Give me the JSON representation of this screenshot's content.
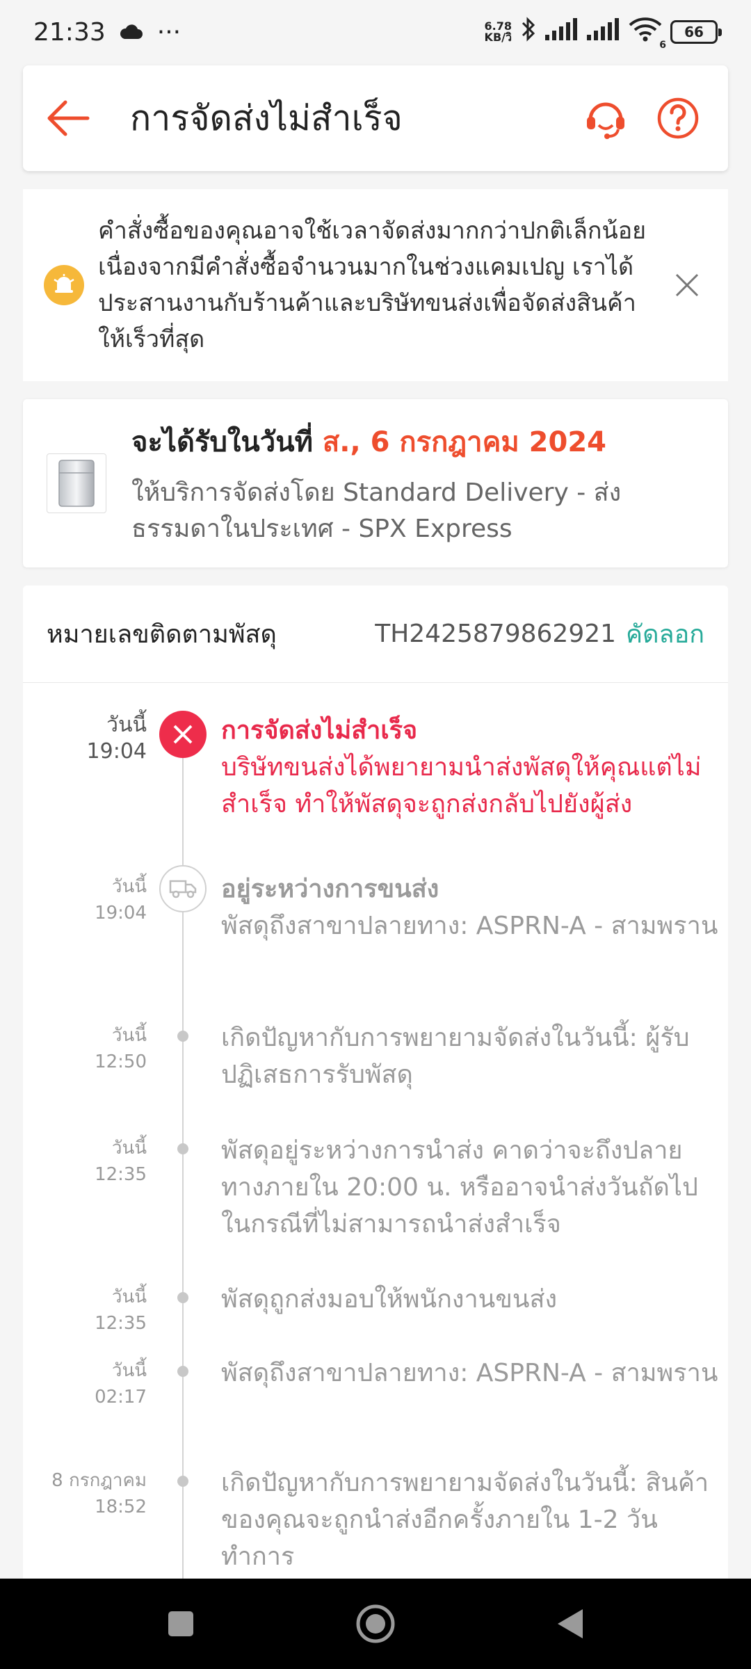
{
  "status_bar": {
    "time": "21:33",
    "dots": "···",
    "net_speed_value": "6.78",
    "net_speed_unit": "KB/วิ",
    "battery": "66",
    "wifi_sub": "6"
  },
  "header": {
    "title": "การจัดส่งไม่สำเร็จ",
    "accent_color": "#ee4d2d"
  },
  "notice": {
    "text": "คำสั่งซื้อของคุณอาจใช้เวลาจัดส่งมากกว่าปกติเล็กน้อย เนื่องจากมีคำสั่งซื้อจำนวนมากในช่วงแคมเปญ เราได้ประสานงานกับร้านค้าและบริษัทขนส่งเพื่อจัดส่งสินค้าให้เร็วที่สุด"
  },
  "delivery": {
    "label": "จะได้รับในวันที่ ",
    "date": "ส., 6 กรกฎาคม 2024",
    "service": "ให้บริการจัดส่งโดย Standard Delivery - ส่งธรรมดาในประเทศ - SPX Express"
  },
  "tracking": {
    "label": "หมายเลขติดตามพัสดุ",
    "number": "TH2425879862921",
    "copy_label": "คัดลอก",
    "events": [
      {
        "day": "วันนี้",
        "time": "19:04",
        "title": "การจัดส่งไม่สำเร็จ",
        "desc": "บริษัทขนส่งได้พยายามนำส่งพัสดุให้คุณแต่ไม่สำเร็จ ทำให้พัสดุจะถูกส่งกลับไปยังผู้ส่ง"
      },
      {
        "day": "วันนี้",
        "time": "19:04",
        "title": "อยู่ระหว่างการขนส่ง",
        "desc": "พัสดุถึงสาขาปลายทาง: ASPRN-A - สามพราน"
      },
      {
        "day": "วันนี้",
        "time": "12:50",
        "desc": "เกิดปัญหากับการพยายามจัดส่งในวันนี้: ผู้รับปฏิเสธการรับพัสดุ"
      },
      {
        "day": "วันนี้",
        "time": "12:35",
        "desc": "พัสดุอยู่ระหว่างการนำส่ง คาดว่าจะถึงปลายทางภายใน 20:00 น. หรืออาจนำส่งวันถัดไปในกรณีที่ไม่สามารถนำส่งสำเร็จ"
      },
      {
        "day": "วันนี้",
        "time": "12:35",
        "desc": "พัสดุถูกส่งมอบให้พนักงานขนส่ง"
      },
      {
        "day": "วันนี้",
        "time": "02:17",
        "desc": "พัสดุถึงสาขาปลายทาง: ASPRN-A - สามพราน"
      },
      {
        "day": "8 กรกฎาคม",
        "time": "18:52",
        "desc": "เกิดปัญหากับการพยายามจัดส่งในวันนี้: สินค้าของคุณจะถูกนำส่งอีกครั้งภายใน 1-2 วันทำการ"
      }
    ]
  }
}
